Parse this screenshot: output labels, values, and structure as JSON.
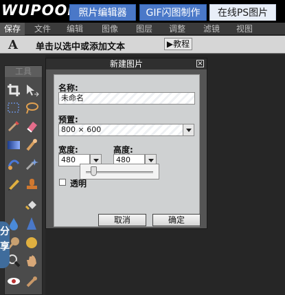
{
  "app": {
    "logo": "WUPOOP"
  },
  "header_tabs": [
    {
      "label": "照片编辑器"
    },
    {
      "label": "GIF闪图制作"
    },
    {
      "label": "在线PS图片"
    }
  ],
  "menu": [
    {
      "label": "保存"
    },
    {
      "label": "文件"
    },
    {
      "label": "编辑"
    },
    {
      "label": "图像"
    },
    {
      "label": "图层"
    },
    {
      "label": "调整"
    },
    {
      "label": "滤镜"
    },
    {
      "label": "视图"
    }
  ],
  "toolbar": {
    "text_tool_glyph": "A",
    "hint": "单击以选中或添加文本",
    "tutorial_label": "▶教程"
  },
  "tools_panel": {
    "title": "工具",
    "tools": [
      "crop-icon",
      "move-icon",
      "marquee-icon",
      "lasso-icon",
      "brush-icon",
      "eraser-icon",
      "gradient-icon",
      "smudge-icon",
      "clone-icon",
      "wand-icon",
      "pencil-icon",
      "stamp-icon",
      "fill-icon",
      "burn-icon",
      "blur-icon",
      "sharpen-icon",
      "dodge-icon",
      "sponge-icon",
      "zoom-icon",
      "hand-icon",
      "eye-icon",
      "picker-icon"
    ]
  },
  "side_share": {
    "label": "分享"
  },
  "dialog": {
    "title": "新建图片",
    "close_glyph": "×",
    "name_label": "名称:",
    "name_value": "未命名",
    "preset_label": "预置:",
    "preset_value": "800 × 600",
    "width_label": "宽度:",
    "width_value": "480",
    "height_label": "高度:",
    "height_value": "480",
    "transparent_label": "透明",
    "cancel_label": "取消",
    "confirm_label": "确定"
  },
  "colors": {
    "header_tab": "#4a78c8",
    "header_tab_active": "#e8eef8",
    "side_share": "#3f6c9c"
  }
}
